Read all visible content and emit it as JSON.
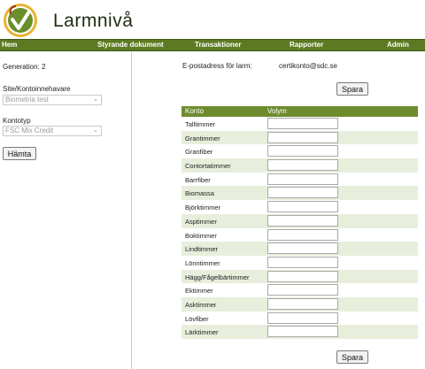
{
  "app": {
    "title": "Larmnivå",
    "logo_icon": "checkmark-leaf-logo"
  },
  "nav": {
    "items": [
      "Hem",
      "Styrande dokument",
      "Transaktioner",
      "Rapporter",
      "Admin"
    ]
  },
  "sidebar": {
    "generation_label": "Generation: 2",
    "site_label": "Site/Kontoinnehavare",
    "site_value": "Biometria test",
    "kontotyp_label": "Kontotyp",
    "kontotyp_value": "FSC Mix Credit",
    "fetch_button": "Hämta"
  },
  "main": {
    "email_label": "E-postadress för larm:",
    "email_value": "certikonto@sdc.se",
    "save_button_top": "Spara",
    "save_button_bottom": "Spara",
    "table": {
      "headers": [
        "Konto",
        "Volym"
      ],
      "rows": [
        "Talltimmer",
        "Grantimmer",
        "Granfiber",
        "Contortatimmer",
        "Barrfiber",
        "Biomassa",
        "Björktimmer",
        "Asptimmer",
        "Boktimmer",
        "Lindtimmer",
        "Lönntimmer",
        "Hägg/Fågelbärtimmer",
        "Ektimmer",
        "Asktimmer",
        "Lövfiber",
        "Lärktimmer"
      ]
    }
  },
  "colors": {
    "nav_bg": "#5c7a22",
    "table_header_bg": "#6e8c2e",
    "alt_row_bg": "#e7eedb"
  }
}
